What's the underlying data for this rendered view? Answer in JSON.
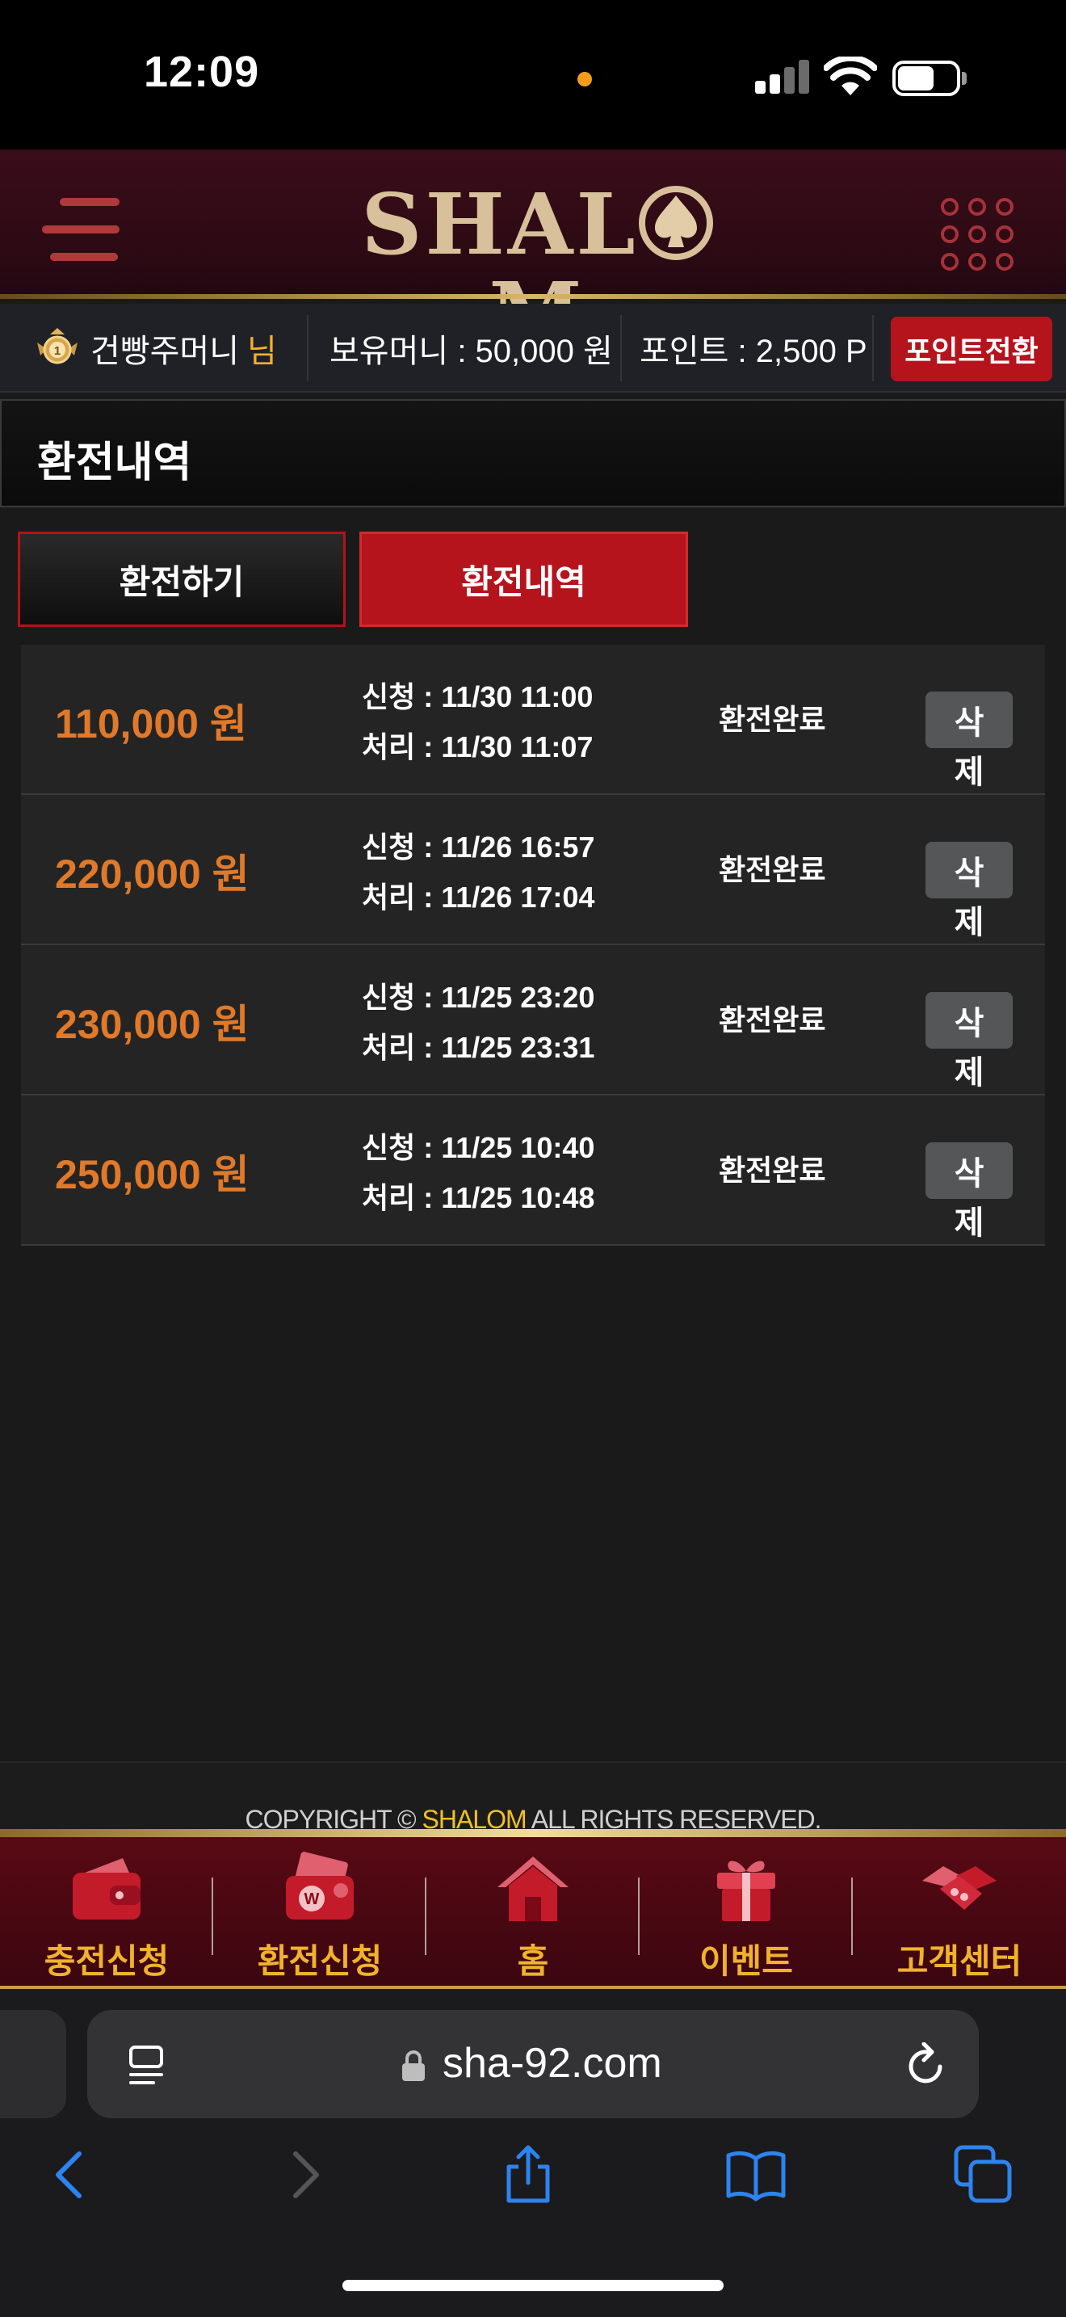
{
  "status_bar": {
    "time": "12:09"
  },
  "header": {
    "logo_text_left": "SHAL",
    "logo_text_right": "M"
  },
  "user_bar": {
    "nickname": "건빵주머니",
    "nickname_suffix": "님",
    "money": "보유머니 : 50,000 원",
    "points": "포인트 : 2,500 P",
    "point_convert_label": "포인트전환"
  },
  "page": {
    "title": "환전내역"
  },
  "tabs": [
    {
      "label": "환전하기",
      "active": false
    },
    {
      "label": "환전내역",
      "active": true
    }
  ],
  "history": [
    {
      "amount": "110,000 원",
      "requested": "신청 : 11/30 11:00",
      "processed": "처리 : 11/30 11:07",
      "status": "환전완료",
      "delete_1": "삭",
      "delete_2": "제"
    },
    {
      "amount": "220,000 원",
      "requested": "신청 : 11/26 16:57",
      "processed": "처리 : 11/26 17:04",
      "status": "환전완료",
      "delete_1": "삭",
      "delete_2": "제"
    },
    {
      "amount": "230,000 원",
      "requested": "신청 : 11/25 23:20",
      "processed": "처리 : 11/25 23:31",
      "status": "환전완료",
      "delete_1": "삭",
      "delete_2": "제"
    },
    {
      "amount": "250,000 원",
      "requested": "신청 : 11/25 10:40",
      "processed": "처리 : 11/25 10:48",
      "status": "환전완료",
      "delete_1": "삭",
      "delete_2": "제"
    }
  ],
  "footer": {
    "copyright_prefix": "COPYRIGHT © ",
    "copyright_brand": "SHALOM",
    "copyright_suffix": " ALL RIGHTS RESERVED."
  },
  "bottom_nav": [
    {
      "label": "충전신청",
      "icon": "wallet-icon"
    },
    {
      "label": "환전신청",
      "icon": "money-exchange-icon"
    },
    {
      "label": "홈",
      "icon": "home-icon"
    },
    {
      "label": "이벤트",
      "icon": "gift-icon"
    },
    {
      "label": "고객센터",
      "icon": "handshake-icon"
    }
  ],
  "browser": {
    "url": "sha-92.com"
  },
  "colors": {
    "accent_red": "#b5141c",
    "amount_orange": "#e0792a",
    "gold": "#f0b22c"
  }
}
